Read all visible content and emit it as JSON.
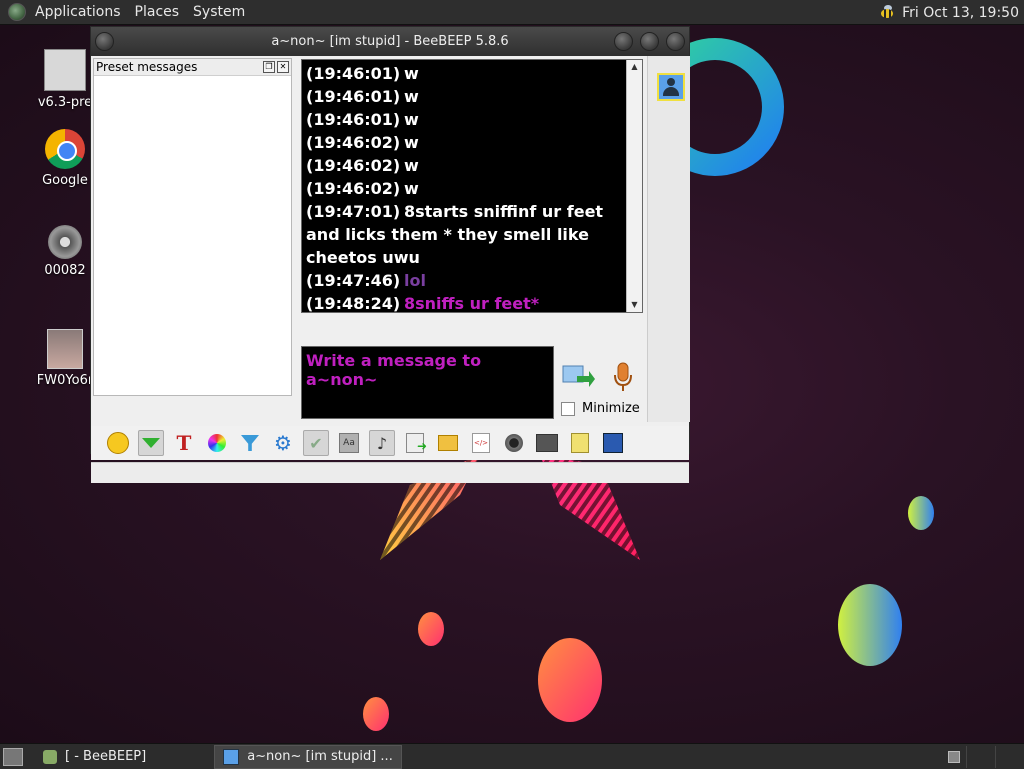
{
  "top_panel": {
    "menu": [
      "Applications",
      "Places",
      "System"
    ],
    "clock": "Fri Oct 13, 19:50"
  },
  "desktop_icons": [
    {
      "label": "v6.3-pre",
      "icon": "home-folder-icon"
    },
    {
      "label": "Google",
      "icon": "chrome-icon"
    },
    {
      "label": "00082",
      "icon": "film-reel-icon"
    },
    {
      "label": "FW0Yo6r",
      "icon": "photo-thumbnail-icon"
    }
  ],
  "window": {
    "title": "a~non~ [im stupid] - BeeBEEP 5.8.6",
    "preset_panel_title": "Preset messages",
    "messages": [
      {
        "time": "(19:46:01)",
        "text": "w",
        "color": "#ffffff"
      },
      {
        "time": "(19:46:01)",
        "text": "w",
        "color": "#ffffff"
      },
      {
        "time": "(19:46:01)",
        "text": "w",
        "color": "#ffffff"
      },
      {
        "time": "(19:46:02)",
        "text": "w",
        "color": "#ffffff"
      },
      {
        "time": "(19:46:02)",
        "text": "w",
        "color": "#ffffff"
      },
      {
        "time": "(19:46:02)",
        "text": "w",
        "color": "#ffffff"
      },
      {
        "time": "(19:47:01)",
        "text": "8starts sniffinf ur feet and licks them * they smell like cheetos uwu",
        "color": "#ffffff"
      },
      {
        "time": "(19:47:46)",
        "text": "lol",
        "color": "#7a3fa0"
      },
      {
        "time": "(19:48:24)",
        "text": "8sniffs ur feet*",
        "color": "#c020c0"
      }
    ],
    "compose_placeholder": "Write a message to a~non~",
    "minimize_label": "Minimize",
    "toolbar_icons": [
      "emoticon-icon",
      "presence-icon",
      "font-icon",
      "color-picker-icon",
      "filter-icon",
      "settings-gear-icon",
      "spellcheck-icon",
      "dictionary-icon",
      "music-note-icon",
      "send-file-icon",
      "share-folder-icon",
      "html-icon",
      "screenshot-icon",
      "history-icon",
      "notes-icon",
      "save-icon"
    ]
  },
  "taskbar": {
    "tasks": [
      {
        "label": "[ - BeeBEEP]",
        "active": false
      },
      {
        "label": "a~non~ [im stupid] ...",
        "active": true
      }
    ]
  },
  "colors": {
    "accent_purple": "#c020c0",
    "muted_purple": "#7a3fa0"
  }
}
